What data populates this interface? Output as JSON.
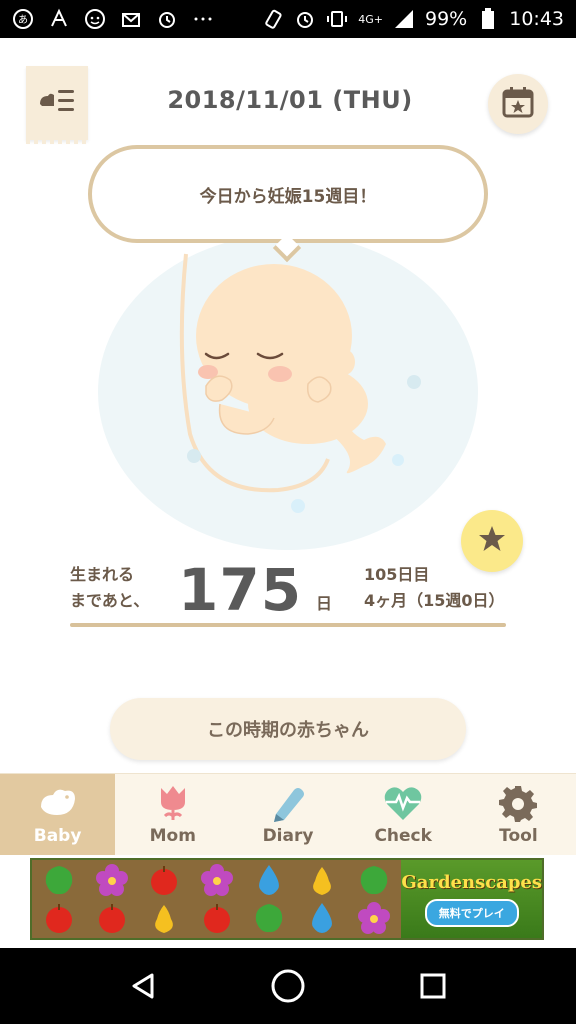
{
  "status_bar": {
    "battery": "99%",
    "time": "10:43",
    "network": "4G+",
    "icons_left": [
      "carrier-icon",
      "app-icon",
      "face-icon",
      "mail-icon",
      "alarm-icon",
      "more-icon"
    ],
    "icons_right": [
      "rotate-icon",
      "alarm-icon",
      "vibrate-icon",
      "signal-icon",
      "battery-icon"
    ]
  },
  "header": {
    "date": "2018/11/01 (THU)"
  },
  "bubble": {
    "text": "今日から妊娠15週目！"
  },
  "countdown": {
    "label_line1": "生まれる",
    "label_line2": "まであと、",
    "days_left": "175",
    "unit": "日",
    "elapsed_days": "105日目",
    "month_week": "4ヶ月（15週0日）"
  },
  "period_button": {
    "label": "この時期の赤ちゃん"
  },
  "nav": {
    "tabs": [
      {
        "label": "Baby",
        "icon": "bird-icon",
        "active": true
      },
      {
        "label": "Mom",
        "icon": "tulip-icon",
        "active": false
      },
      {
        "label": "Diary",
        "icon": "pencil-icon",
        "active": false
      },
      {
        "label": "Check",
        "icon": "heart-pulse-icon",
        "active": false
      },
      {
        "label": "Tool",
        "icon": "gear-icon",
        "active": false
      }
    ]
  },
  "ad": {
    "logo": "Gardenscapes",
    "play_label": "無料でプレイ"
  },
  "colors": {
    "accent": "#e2c9a0",
    "bubble_border": "#dcc7a2",
    "star_bg": "#fbe98a",
    "baby_circle": "#eef6f8"
  }
}
